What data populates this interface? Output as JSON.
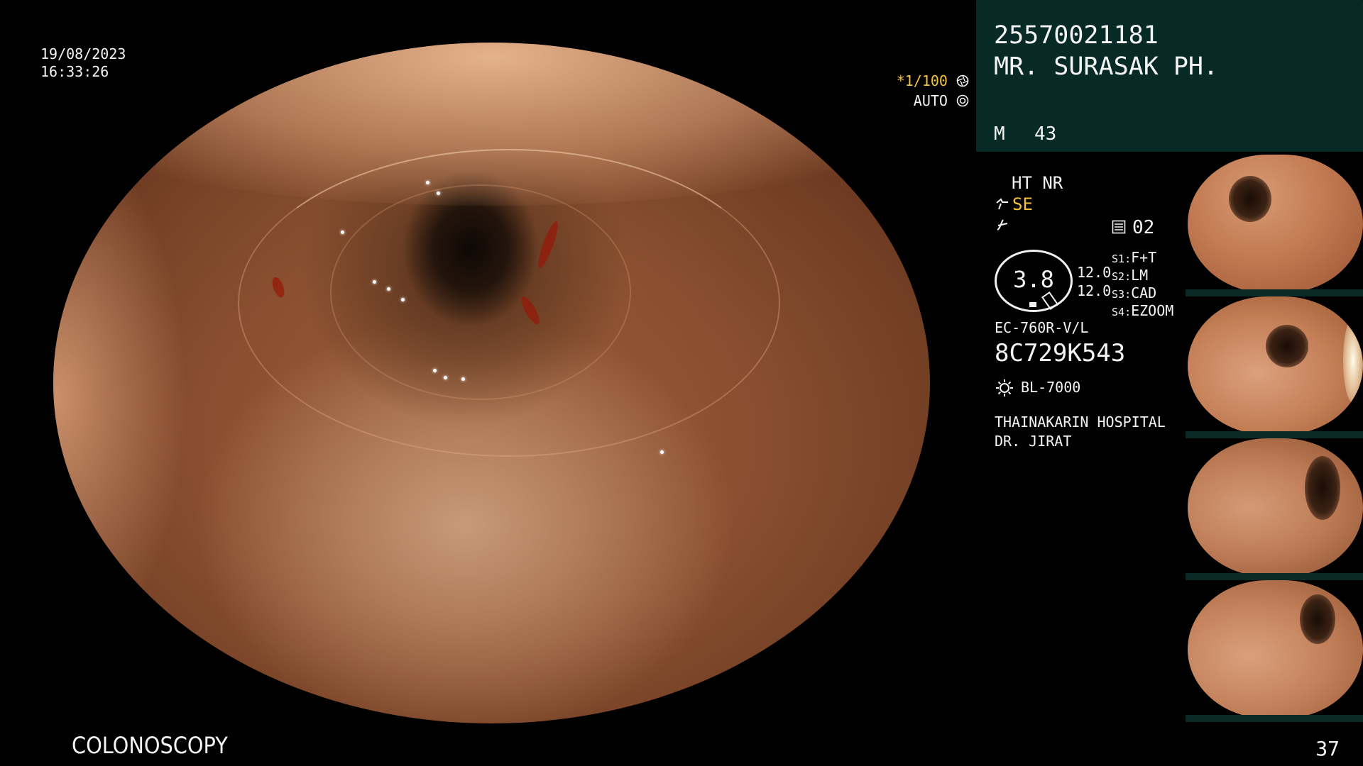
{
  "overlay": {
    "date": "19/08/2023",
    "time": "16:33:26",
    "shutter": "*1/100",
    "iris": "AUTO",
    "procedure": "COLONOSCOPY",
    "frame_number": "37"
  },
  "patient": {
    "id": "25570021181",
    "name": "MR. SURASAK PH.",
    "sex": "M",
    "age": "43"
  },
  "settings": {
    "mode": "HT NR",
    "enhance": "SE",
    "memory": "02",
    "gauge_value": "3.8",
    "value_top": "12.0",
    "value_bottom": "12.0",
    "switches": [
      {
        "key": "S1",
        "value": "F+T"
      },
      {
        "key": "S2",
        "value": "LM"
      },
      {
        "key": "S3",
        "value": "CAD"
      },
      {
        "key": "S4",
        "value": "EZOOM"
      }
    ],
    "scope_model": "EC-760R-V/L",
    "scope_serial": "8C729K543",
    "light_source": "BL-7000",
    "hospital": "THAINAKARIN HOSPITAL",
    "doctor": "DR. JIRAT"
  },
  "colors": {
    "panel_bg": "#082a26",
    "accent_yellow": "#f2c23a",
    "text": "#f4f4f4"
  },
  "icons": [
    "shutter-icon",
    "iris-icon",
    "enhance-icon",
    "color-icon",
    "memory-icon",
    "light-source-icon"
  ]
}
